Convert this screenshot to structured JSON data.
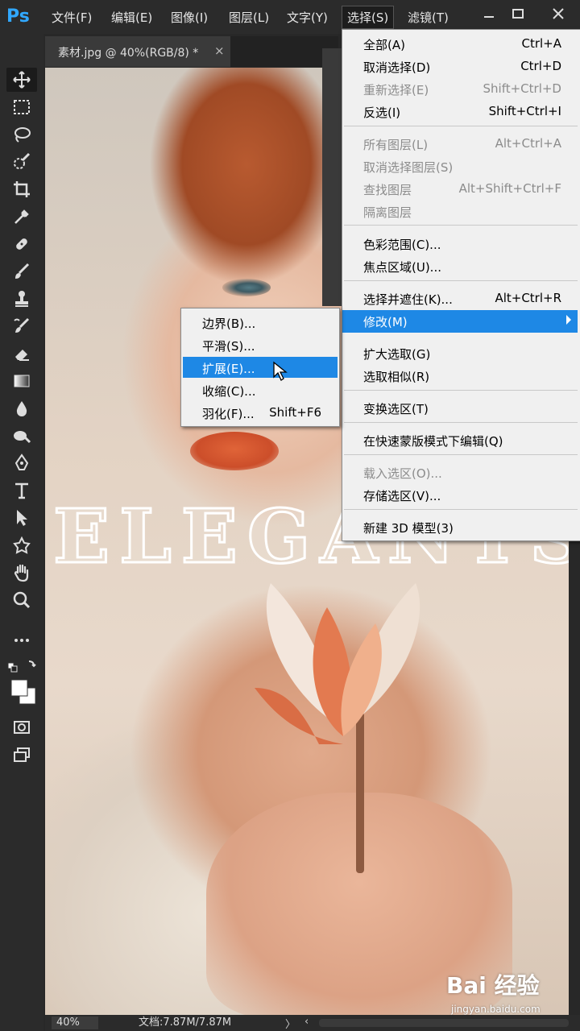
{
  "app": {
    "logo": "Ps"
  },
  "menubar": {
    "items": [
      "文件(F)",
      "编辑(E)",
      "图像(I)",
      "图层(L)",
      "文字(Y)",
      "选择(S)",
      "滤镜(T)"
    ],
    "active": "选择(S)"
  },
  "document": {
    "tab_label": "素材.jpg @ 40%(RGB/8) *",
    "close": "×"
  },
  "canvas": {
    "overlay_text": "ELEGANTS"
  },
  "select_menu": {
    "items": [
      {
        "label": "全部(A)",
        "shortcut": "Ctrl+A",
        "disabled": false
      },
      {
        "label": "取消选择(D)",
        "shortcut": "Ctrl+D",
        "disabled": false
      },
      {
        "label": "重新选择(E)",
        "shortcut": "Shift+Ctrl+D",
        "disabled": true
      },
      {
        "label": "反选(I)",
        "shortcut": "Shift+Ctrl+I",
        "disabled": false
      },
      {
        "label": "所有图层(L)",
        "shortcut": "Alt+Ctrl+A",
        "disabled": true
      },
      {
        "label": "取消选择图层(S)",
        "shortcut": "",
        "disabled": true
      },
      {
        "label": "查找图层",
        "shortcut": "Alt+Shift+Ctrl+F",
        "disabled": true
      },
      {
        "label": "隔离图层",
        "shortcut": "",
        "disabled": true
      },
      {
        "label": "色彩范围(C)...",
        "shortcut": "",
        "disabled": false
      },
      {
        "label": "焦点区域(U)...",
        "shortcut": "",
        "disabled": false
      },
      {
        "label": "选择并遮住(K)...",
        "shortcut": "Alt+Ctrl+R",
        "disabled": false
      },
      {
        "label": "修改(M)",
        "shortcut": "",
        "disabled": false,
        "highlighted": true
      },
      {
        "label": "扩大选取(G)",
        "shortcut": "",
        "disabled": false
      },
      {
        "label": "选取相似(R)",
        "shortcut": "",
        "disabled": false
      },
      {
        "label": "变换选区(T)",
        "shortcut": "",
        "disabled": false
      },
      {
        "label": "在快速蒙版模式下编辑(Q)",
        "shortcut": "",
        "disabled": false
      },
      {
        "label": "载入选区(O)...",
        "shortcut": "",
        "disabled": true
      },
      {
        "label": "存储选区(V)...",
        "shortcut": "",
        "disabled": false
      },
      {
        "label": "新建 3D 模型(3)",
        "shortcut": "",
        "disabled": false
      }
    ]
  },
  "modify_submenu": {
    "items": [
      {
        "label": "边界(B)...",
        "shortcut": ""
      },
      {
        "label": "平滑(S)...",
        "shortcut": ""
      },
      {
        "label": "扩展(E)...",
        "shortcut": "",
        "highlighted": true
      },
      {
        "label": "收缩(C)...",
        "shortcut": ""
      },
      {
        "label": "羽化(F)...",
        "shortcut": "Shift+F6"
      }
    ]
  },
  "status": {
    "zoom": "40%",
    "doc_size": "文档:7.87M/7.87M",
    "arrow": "〉",
    "scroll_left": "‹"
  },
  "watermark": {
    "brand": "Bai 经验",
    "url": "jingyan.baidu.com"
  },
  "colors": {
    "highlight": "#1e88e5",
    "menu_bg": "#f0f0f0",
    "ui_dark": "#2b2b2b",
    "ps_blue": "#31a8ff"
  },
  "icons": [
    "move-tool-icon",
    "marquee-tool-icon",
    "lasso-tool-icon",
    "quick-select-tool-icon",
    "crop-tool-icon",
    "eyedropper-tool-icon",
    "healing-brush-icon",
    "brush-tool-icon",
    "clone-stamp-icon",
    "history-brush-icon",
    "eraser-tool-icon",
    "gradient-tool-icon",
    "blur-tool-icon",
    "dodge-tool-icon",
    "pen-tool-icon",
    "type-tool-icon",
    "path-select-icon",
    "shape-tool-icon",
    "hand-tool-icon",
    "zoom-tool-icon",
    "more-tools-icon"
  ]
}
